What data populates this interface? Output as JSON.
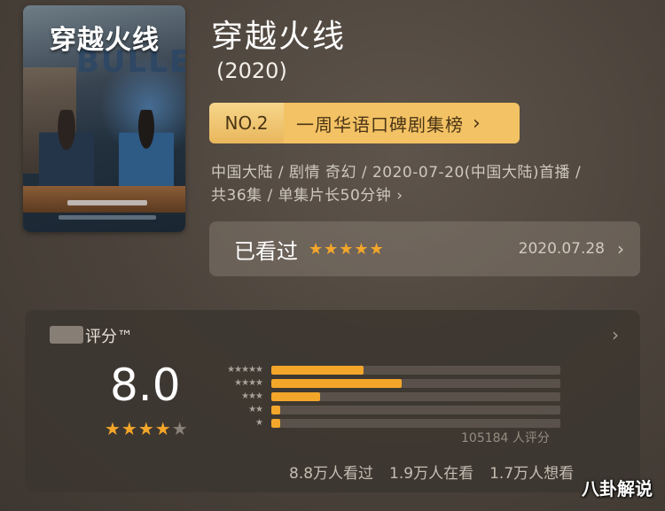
{
  "movie": {
    "title": "穿越火线",
    "year": "(2020)",
    "poster_title": "穿越火线",
    "poster_subtitle": "BULLET"
  },
  "rank": {
    "number": "NO.2",
    "label": "一周华语口碑剧集榜"
  },
  "meta": {
    "line1": "中国大陆 / 剧情 奇幻 / 2020-07-20(中国大陆)首播 /",
    "line2": "共36集 / 单集片长50分钟 ›"
  },
  "watched": {
    "label": "已看过",
    "stars": "★★★★★",
    "user_rating": 5,
    "date": "2020.07.28"
  },
  "rating": {
    "title": "评分™",
    "score": "8.0",
    "stars_filled": "★★★★",
    "stars_empty": "★",
    "distribution": [
      {
        "stars": "★★★★★",
        "fraction": 0.32
      },
      {
        "stars": "★★★★",
        "fraction": 0.45
      },
      {
        "stars": "★★★",
        "fraction": 0.17
      },
      {
        "stars": "★★",
        "fraction": 0.03
      },
      {
        "stars": "★",
        "fraction": 0.03
      }
    ],
    "count": "105184 人评分",
    "watched_count": "8.8万人看过",
    "watching_count": "1.9万人在看",
    "want_count": "1.7万人想看"
  },
  "watermark": "八卦解说",
  "colors": {
    "accent": "#f4a62a",
    "rank_bg": "#f3c264"
  }
}
